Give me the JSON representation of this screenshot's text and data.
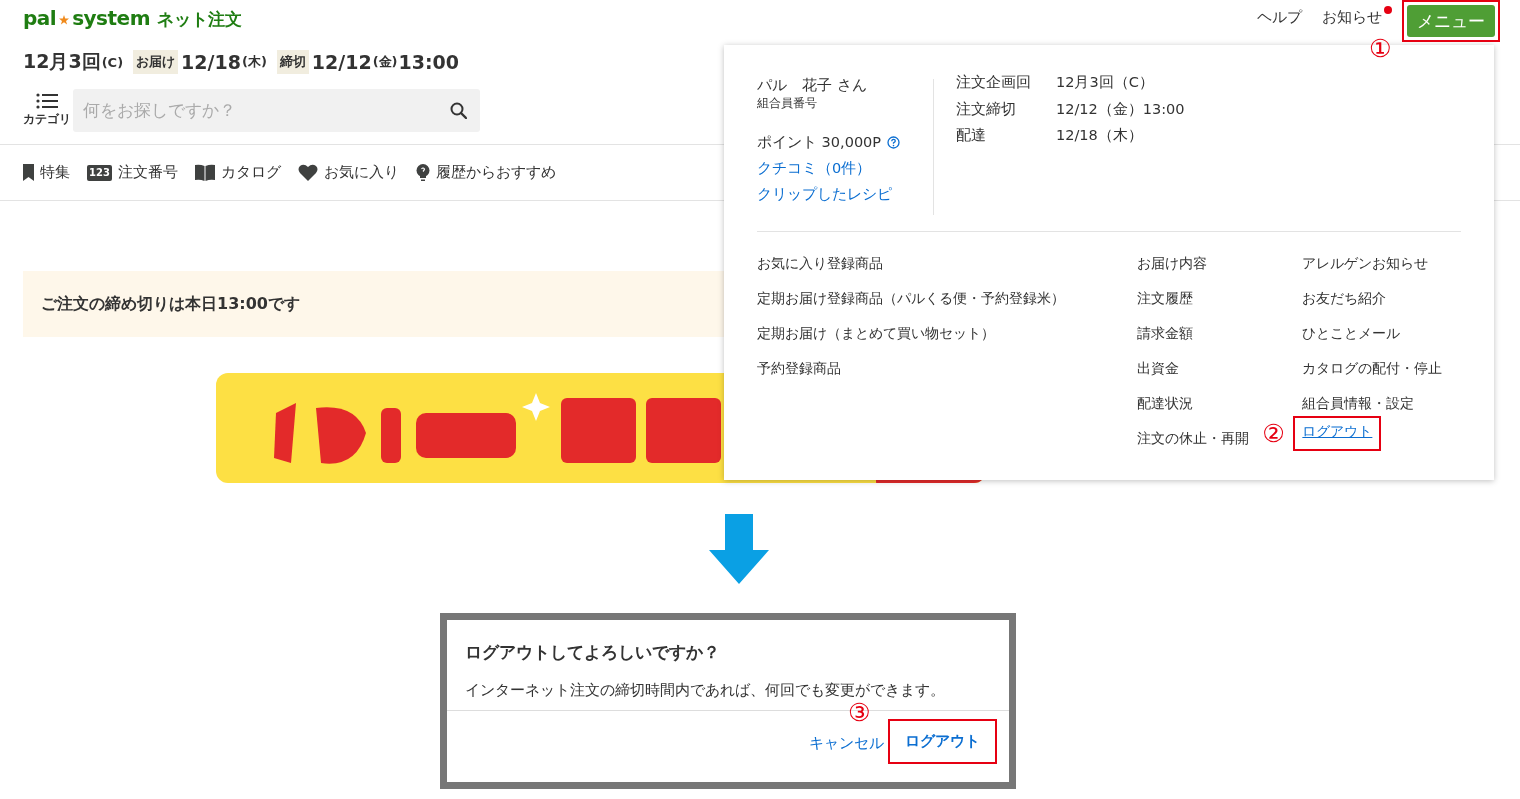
{
  "header": {
    "logo": {
      "brand_left": "pal",
      "brand_right": "system",
      "service": "ネット注文"
    },
    "links": [
      {
        "label": "ヘルプ",
        "badge": false
      },
      {
        "label": "お知らせ",
        "badge": true
      }
    ],
    "menu_button": {
      "label": "メニュー",
      "step": "①"
    }
  },
  "schedule": {
    "round": "12月3回",
    "round_code": "(C)",
    "items": [
      {
        "tag": "お届け",
        "date": "12/18",
        "weekday": "(木)"
      },
      {
        "tag": "締切",
        "date": "12/12",
        "weekday": "(金)",
        "time": "13:00"
      }
    ]
  },
  "search": {
    "category_label": "カテゴリ",
    "placeholder": "何をお探しですか？"
  },
  "nav": [
    {
      "kind": "bookmark",
      "label": "特集"
    },
    {
      "kind": "number",
      "icon_text": "123",
      "label": "注文番号"
    },
    {
      "kind": "book",
      "label": "カタログ"
    },
    {
      "kind": "heart",
      "label": "お気に入り"
    },
    {
      "kind": "bulb",
      "label": "履歴からおすすめ"
    }
  ],
  "notice": "ご注文の締め切りは本日13:00です",
  "menu": {
    "member": {
      "name": "パル　花子 さん",
      "id_label": "組合員番号",
      "points": "ポイント  30,000P",
      "links": [
        "クチコミ（0件）",
        "クリップしたレシピ"
      ]
    },
    "order_info": [
      {
        "label": "注文企画回",
        "value": "12月3回（C）"
      },
      {
        "label": "注文締切",
        "value": "12/12（金）13:00"
      },
      {
        "label": "配達",
        "value": "12/18（木）"
      }
    ],
    "columns": [
      [
        {
          "label": "お気に入り登録商品",
          "kind": "plain"
        },
        {
          "label": "定期お届け登録商品（パルくる便・予約登録米）",
          "kind": "plain"
        },
        {
          "label": "定期お届け（まとめて買い物セット）",
          "kind": "plain"
        },
        {
          "label": "予約登録商品",
          "kind": "plain"
        }
      ],
      [
        {
          "label": "お届け内容",
          "kind": "plain"
        },
        {
          "label": "注文履歴",
          "kind": "plain"
        },
        {
          "label": "請求金額",
          "kind": "plain"
        },
        {
          "label": "出資金",
          "kind": "plain"
        },
        {
          "label": "配達状況",
          "kind": "plain"
        },
        {
          "label": "注文の休止・再開",
          "kind": "plain"
        }
      ],
      [
        {
          "label": "アレルゲンお知らせ",
          "kind": "plain"
        },
        {
          "label": "お友だち紹介",
          "kind": "plain"
        },
        {
          "label": "ひとことメール",
          "kind": "plain"
        },
        {
          "label": "カタログの配付・停止",
          "kind": "plain"
        },
        {
          "label": "組合員情報・設定",
          "kind": "plain"
        },
        {
          "label": "ログアウト",
          "kind": "link",
          "step": "②"
        }
      ]
    ]
  },
  "dialog": {
    "title": "ログアウトしてよろしいですか？",
    "message": "インターネット注文の締切時間内であれば、何回でも変更ができます。",
    "buttons": [
      {
        "label": "キャンセル",
        "kind": "text"
      },
      {
        "label": "ログアウト",
        "kind": "primary",
        "step": "③"
      }
    ]
  }
}
